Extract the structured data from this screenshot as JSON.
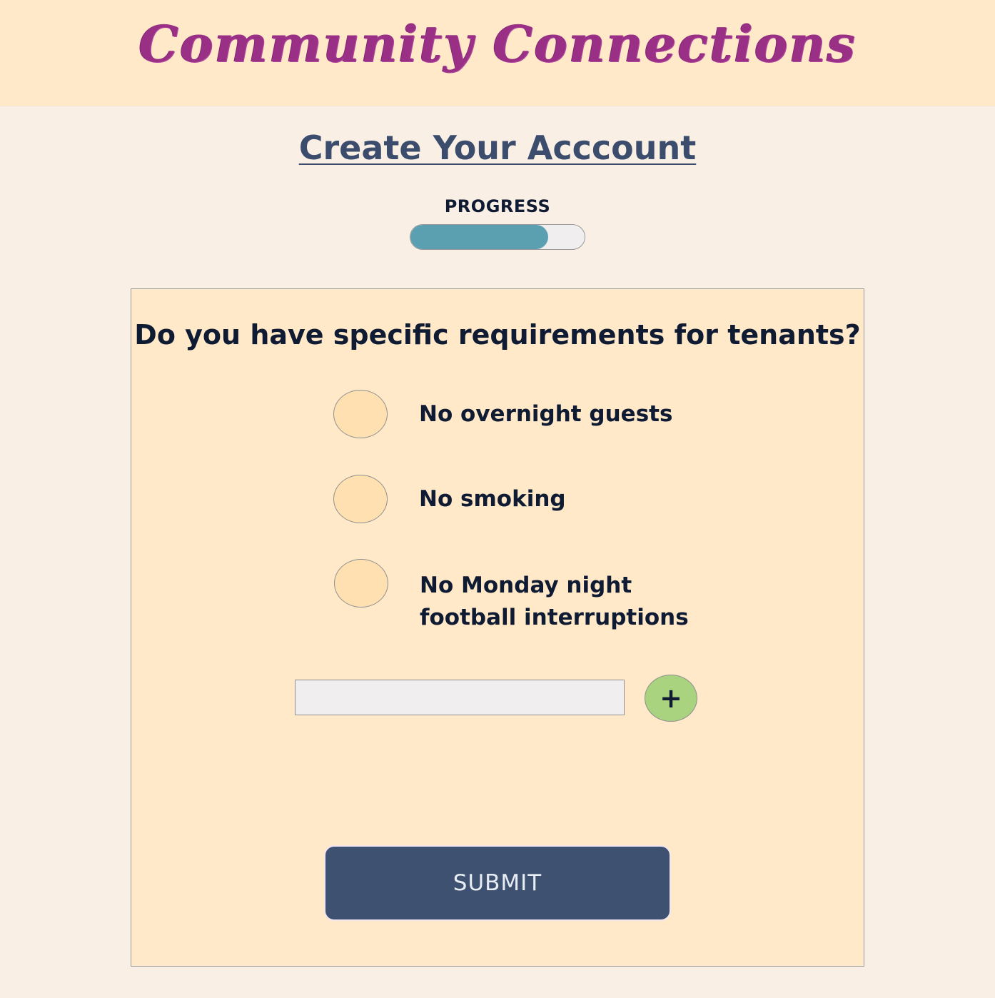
{
  "header": {
    "brand": "Community Connections",
    "brand_color": "#9a2f86"
  },
  "page": {
    "title": "Create Your Acccount"
  },
  "progress": {
    "label": "PROGRESS",
    "value_percent": 79,
    "fill_color": "#5ba0b0"
  },
  "form": {
    "question": "Do you have specific requirements for tenants?",
    "options": [
      {
        "label": "No overnight guests",
        "selected": false
      },
      {
        "label": "No smoking",
        "selected": false
      },
      {
        "label": "No Monday night\nfootball interruptions",
        "selected": false
      }
    ],
    "add_input": {
      "value": "",
      "placeholder": ""
    },
    "add_button": {
      "label": "+",
      "icon": "plus-icon",
      "color": "#a9d37e"
    },
    "submit_label": "SUBMIT",
    "submit_color": "#3e5170"
  }
}
